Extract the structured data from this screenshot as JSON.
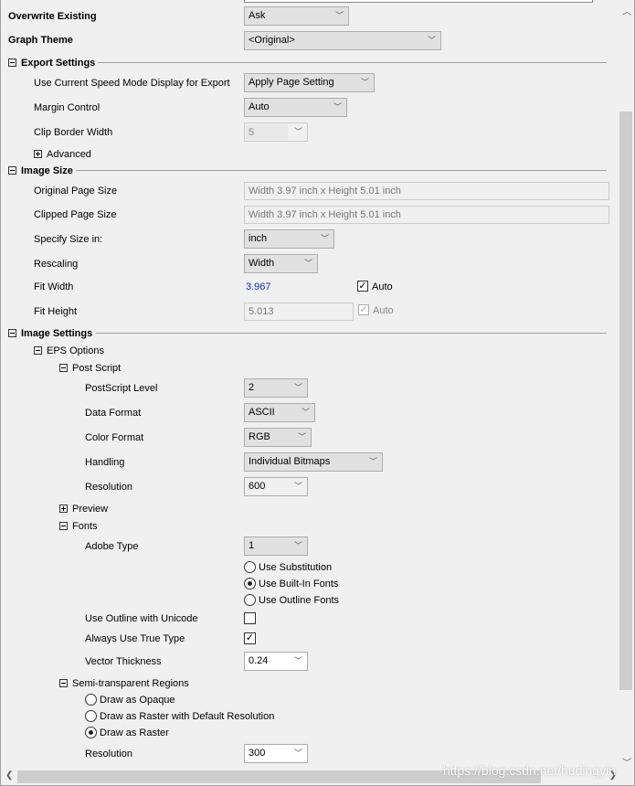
{
  "overwrite": {
    "label": "Overwrite Existing",
    "value": "Ask"
  },
  "graph_theme": {
    "label": "Graph Theme",
    "value": "<Original>"
  },
  "export_settings": {
    "title": "Export Settings",
    "speed_mode": {
      "label": "Use Current Speed Mode Display for Export",
      "value": "Apply Page Setting"
    },
    "margin": {
      "label": "Margin Control",
      "value": "Auto"
    },
    "clip_border": {
      "label": "Clip Border Width",
      "value": "5"
    },
    "advanced": "Advanced"
  },
  "image_size": {
    "title": "Image Size",
    "original": {
      "label": "Original Page Size",
      "value": "Width 3.97 inch x Height 5.01 inch"
    },
    "clipped": {
      "label": "Clipped Page Size",
      "value": "Width 3.97 inch x Height 5.01 inch"
    },
    "specify": {
      "label": "Specify Size in:",
      "value": "inch"
    },
    "rescaling": {
      "label": "Rescaling",
      "value": "Width"
    },
    "fit_width": {
      "label": "Fit Width",
      "value": "3.967",
      "auto_label": "Auto",
      "auto_checked": true
    },
    "fit_height": {
      "label": "Fit Height",
      "value": "5.013",
      "auto_label": "Auto",
      "auto_checked": true
    }
  },
  "image_settings": {
    "title": "Image Settings",
    "eps": "EPS Options",
    "postscript": {
      "title": "Post Script",
      "level": {
        "label": "PostScript Level",
        "value": "2"
      },
      "data_format": {
        "label": "Data Format",
        "value": "ASCII"
      },
      "color_format": {
        "label": "Color Format",
        "value": "RGB"
      },
      "handling": {
        "label": "Handling",
        "value": "Individual Bitmaps"
      },
      "resolution": {
        "label": "Resolution",
        "value": "600"
      }
    },
    "preview": "Preview",
    "fonts": {
      "title": "Fonts",
      "adobe": {
        "label": "Adobe Type",
        "value": "1"
      },
      "options": [
        "Use Substitution",
        "Use Built-In Fonts",
        "Use Outline Fonts"
      ],
      "selected": "Use Built-In Fonts",
      "outline_unicode": {
        "label": "Use Outline with Unicode",
        "checked": false
      },
      "true_type": {
        "label": "Always Use True Type",
        "checked": true
      },
      "vector": {
        "label": "Vector Thickness",
        "value": "0.24"
      }
    },
    "semi": {
      "title": "Semi-transparent Regions",
      "options": [
        "Draw as Opaque",
        "Draw as Raster with Default Resolution",
        "Draw as Raster"
      ],
      "selected": "Draw as Raster",
      "resolution": {
        "label": "Resolution",
        "value": "300"
      }
    }
  },
  "watermark": "https://blog.csdn.net/hudingyin",
  "colors": {
    "link_value": "#0033cc"
  }
}
